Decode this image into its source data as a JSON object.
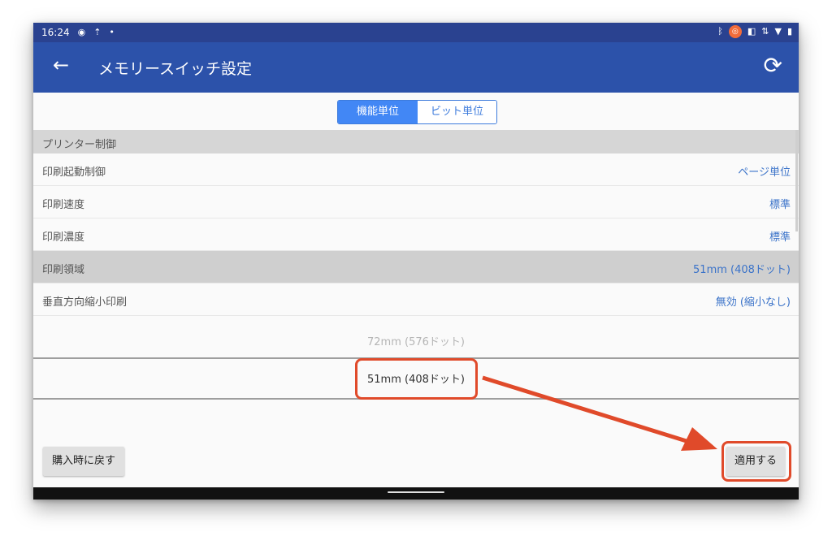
{
  "status_bar": {
    "time": "16:24",
    "icons_left": [
      "location-icon",
      "upload-icon",
      "dot-icon"
    ],
    "icons_right": [
      "bluetooth-icon",
      "app-badge-icon",
      "vibrate-icon",
      "data-icon",
      "wifi-icon",
      "battery-icon"
    ]
  },
  "app_bar": {
    "title": "メモリースイッチ設定",
    "back_icon": "←",
    "refresh_icon": "⟳"
  },
  "segment": {
    "options": [
      "機能単位",
      "ビット単位"
    ],
    "selected": "機能単位"
  },
  "settings": [
    {
      "label": "プリンター制御",
      "value": "",
      "type": "header"
    },
    {
      "label": "印刷起動制御",
      "value": "ページ単位"
    },
    {
      "label": "印刷速度",
      "value": "標準"
    },
    {
      "label": "印刷濃度",
      "value": "標準"
    },
    {
      "label": "印刷領域",
      "value": "51mm (408ドット)",
      "selected": true
    },
    {
      "label": "垂直方向縮小印刷",
      "value": "無効 (縮小なし)"
    }
  ],
  "picker": {
    "upper_option": "72mm (576ドット)",
    "selected_option": "51mm (408ドット)"
  },
  "buttons": {
    "reset_label": "購入時に戻す",
    "apply_label": "適用する"
  },
  "colors": {
    "app_bar": "#2c52aa",
    "status_bar": "#2a4290",
    "accent": "#3b73c9",
    "highlight": "#e04a2a"
  }
}
